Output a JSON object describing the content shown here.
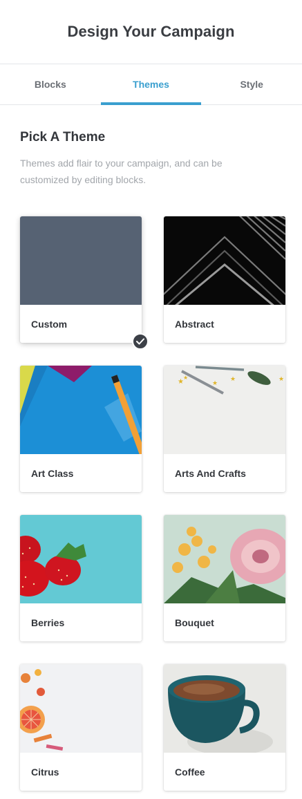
{
  "header": {
    "title": "Design Your Campaign"
  },
  "tabs": [
    {
      "label": "Blocks",
      "active": false
    },
    {
      "label": "Themes",
      "active": true
    },
    {
      "label": "Style",
      "active": false
    }
  ],
  "section": {
    "title": "Pick A Theme",
    "description": "Themes add flair to your campaign, and can be customized by editing blocks."
  },
  "themes": [
    {
      "name": "Custom",
      "selected": true,
      "thumb_color": "#566273"
    },
    {
      "name": "Abstract",
      "selected": false
    },
    {
      "name": "Art Class",
      "selected": false
    },
    {
      "name": "Arts And Crafts",
      "selected": false
    },
    {
      "name": "Berries",
      "selected": false
    },
    {
      "name": "Bouquet",
      "selected": false
    },
    {
      "name": "Citrus",
      "selected": false
    },
    {
      "name": "Coffee",
      "selected": false
    }
  ],
  "colors": {
    "accent": "#3a9fcf",
    "check_badge": "#3c4047"
  },
  "icons": {
    "selected_check": "check-icon"
  }
}
